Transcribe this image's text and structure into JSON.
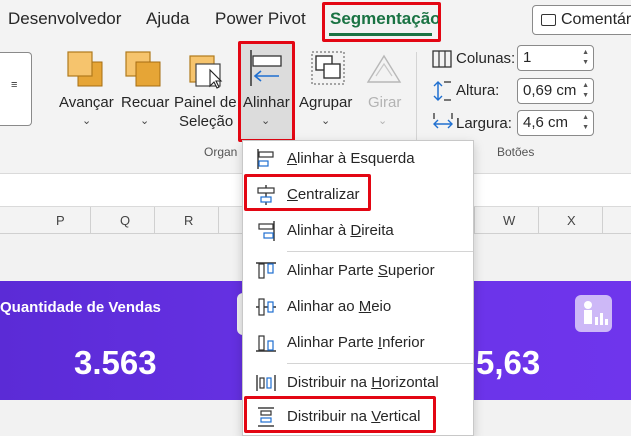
{
  "tabs": [
    {
      "label": "Desenvolvedor"
    },
    {
      "label": "Ajuda"
    },
    {
      "label": "Power Pivot"
    },
    {
      "label": "Segmentação"
    }
  ],
  "comment_button": "Comentár",
  "ribbon": {
    "avancar": "Avançar",
    "recuar": "Recuar",
    "painel_line1": "Painel de",
    "painel_line2": "Seleção",
    "alinhar": "Alinhar",
    "agrupar": "Agrupar",
    "girar": "Girar",
    "group_organizar": "Organ",
    "group_botoes": "Botões",
    "colunas_label": "Colunas:",
    "colunas_value": "1",
    "altura_label": "Altura:",
    "altura_value": "0,69 cm",
    "largura_label": "Largura:",
    "largura_value": "4,6 cm"
  },
  "columns": [
    "P",
    "Q",
    "R",
    "W",
    "X"
  ],
  "card": {
    "title": "Quantidade de Vendas",
    "value": "3.563",
    "value_partial": "5,63"
  },
  "menu": {
    "items": [
      {
        "pre": "",
        "key": "A",
        "post": "linhar à Esquerda",
        "icon": "align-left-icon"
      },
      {
        "pre": "",
        "key": "C",
        "post": "entralizar",
        "icon": "align-center-icon"
      },
      {
        "pre": "Alinhar à ",
        "key": "D",
        "post": "ireita",
        "icon": "align-right-icon"
      },
      {
        "pre": "Alinhar Parte ",
        "key": "S",
        "post": "uperior",
        "icon": "align-top-icon"
      },
      {
        "pre": "Alinhar ao ",
        "key": "M",
        "post": "eio",
        "icon": "align-middle-icon"
      },
      {
        "pre": "Alinhar Parte ",
        "key": "I",
        "post": "nferior",
        "icon": "align-bottom-icon"
      },
      {
        "pre": "Distribuir na ",
        "key": "H",
        "post": "orizontal",
        "icon": "distribute-horizontal-icon"
      },
      {
        "pre": "Distribuir na ",
        "key": "V",
        "post": "ertical",
        "icon": "distribute-vertical-icon"
      }
    ]
  },
  "colors": {
    "accent_green": "#1a7343",
    "highlight_red": "#e30613",
    "card_purple": "#5b2bd6"
  }
}
